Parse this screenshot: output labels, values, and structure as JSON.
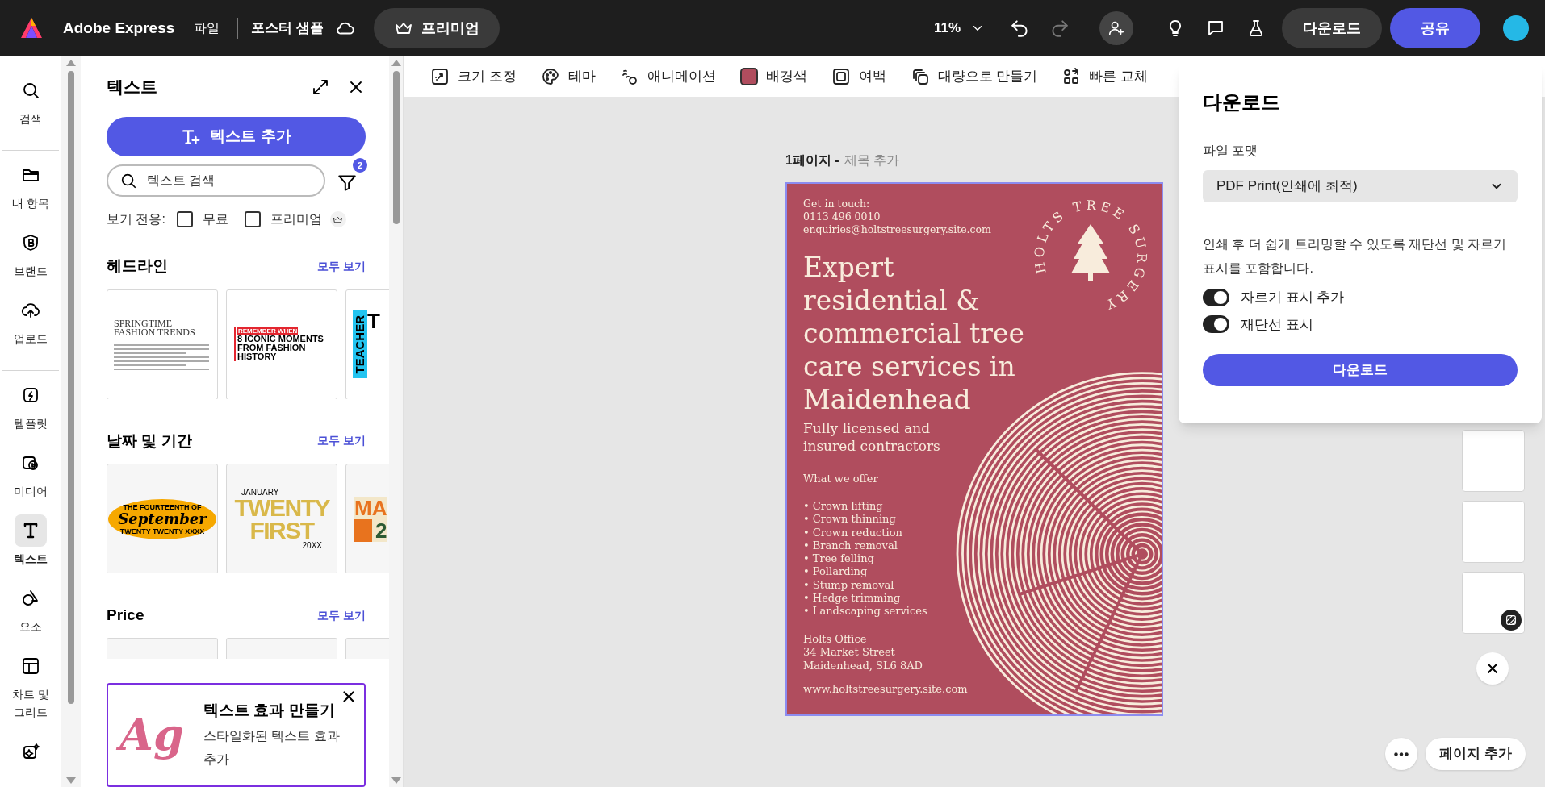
{
  "top_bar": {
    "app_name": "Adobe Express",
    "menu": "파일",
    "document_title": "포스터 샘플",
    "premium_button": "프리미엄",
    "zoom": "11%",
    "download_button": "다운로드",
    "share_button": "공유"
  },
  "rail": {
    "groups": [
      [
        {
          "label": "검색",
          "selected": false
        }
      ],
      [
        {
          "label": "내 항목",
          "selected": false
        },
        {
          "label": "브랜드",
          "selected": false
        },
        {
          "label": "업로드",
          "selected": false
        }
      ],
      [
        {
          "label": "템플릿",
          "selected": false
        },
        {
          "label": "미디어",
          "selected": false
        },
        {
          "label": "텍스트",
          "selected": true
        },
        {
          "label": "요소",
          "selected": false
        },
        {
          "label": "차트 및 그리드",
          "selected": false
        },
        {
          "selected": false
        }
      ]
    ]
  },
  "panel": {
    "title": "텍스트",
    "add_text_button": "텍스트 추가",
    "search": {
      "placeholder": "텍스트 검색"
    },
    "filter_count": "2",
    "view_only": {
      "label": "보기 전용:",
      "options": [
        {
          "label": "무료",
          "checked": false
        },
        {
          "label": "프리미엄",
          "checked": false
        }
      ]
    },
    "sections": [
      {
        "title": "헤드라인",
        "see_all": "모두 보기",
        "cards": [
          {
            "kind": "editorial",
            "title": "SPRINGTIME FASHION TRENDS"
          },
          {
            "kind": "banner",
            "tag": "REMEMBER WHEN",
            "title": "8 ICONIC MOMENTS FROM FASHION HISTORY"
          },
          {
            "kind": "vertical",
            "title": "TEACHER",
            "extra": "T"
          }
        ]
      },
      {
        "title": "날짜 및 기간",
        "see_all": "모두 보기",
        "cards": [
          {
            "kind": "script",
            "top": "THE FOURTEENTH OF",
            "title": "September",
            "bottom": "TWENTY TWENTY XXXX"
          },
          {
            "kind": "handdrawn",
            "top": "JANUARY",
            "title": "TWENTY FIRST",
            "bottom": "20XX"
          },
          {
            "kind": "blocks",
            "title": "MA",
            "extra": "2"
          }
        ]
      },
      {
        "title": "Price",
        "see_all": "모두 보기",
        "cards": [
          {
            "kind": "blank"
          },
          {
            "kind": "blank"
          },
          {
            "kind": "blank"
          }
        ]
      }
    ],
    "promo": {
      "artwork_text": "Ag",
      "title": "텍스트 효과 만들기",
      "text": "스타일화된 텍스트 효과 추가"
    }
  },
  "toolbar": {
    "items": [
      {
        "label": "크기 조정"
      },
      {
        "label": "테마"
      },
      {
        "label": "애니메이션"
      },
      {
        "label": "배경색",
        "color": "#b04d5e"
      },
      {
        "label": "여백"
      },
      {
        "label": "대량으로 만들기"
      },
      {
        "label": "빠른 교체"
      }
    ]
  },
  "page": {
    "label": "1페이지 -",
    "title": "제목 추가"
  },
  "poster": {
    "contact": [
      "Get in touch:",
      "0113 496 0010",
      "enquiries@holtstreesurgery.site.com"
    ],
    "headline": [
      "Expert",
      "residential &",
      "commercial tree",
      "care services in",
      "Maidenhead"
    ],
    "subheadline": [
      "Fully licensed and",
      "insured contractors"
    ],
    "offer_title": "What we offer",
    "services": [
      "• Crown lifting",
      "• Crown thinning",
      "• Crown reduction",
      "• Branch removal",
      "• Tree felling",
      "• Pollarding",
      "• Stump removal",
      "• Hedge trimming",
      "• Landscaping services"
    ],
    "address": [
      "Holts Office",
      "34 Market Street",
      "Maidenhead, SL6 8AD"
    ],
    "website": "www.holtstreesurgery.site.com",
    "badge_text": "HOLTS TREE SURGERY"
  },
  "download_panel": {
    "title": "다운로드",
    "format_label": "파일 포맷",
    "format_value": "PDF Print(인쇄에 최적)",
    "description": "인쇄 후 더 쉽게 트리밍할 수 있도록 재단선 및 자르기 표시를 포함합니다.",
    "toggles": [
      {
        "label": "자르기 표시 추가",
        "on": true
      },
      {
        "label": "재단선 표시",
        "on": true
      }
    ],
    "button": "다운로드"
  },
  "page_actions": {
    "add_page_button": "페이지 추가"
  }
}
